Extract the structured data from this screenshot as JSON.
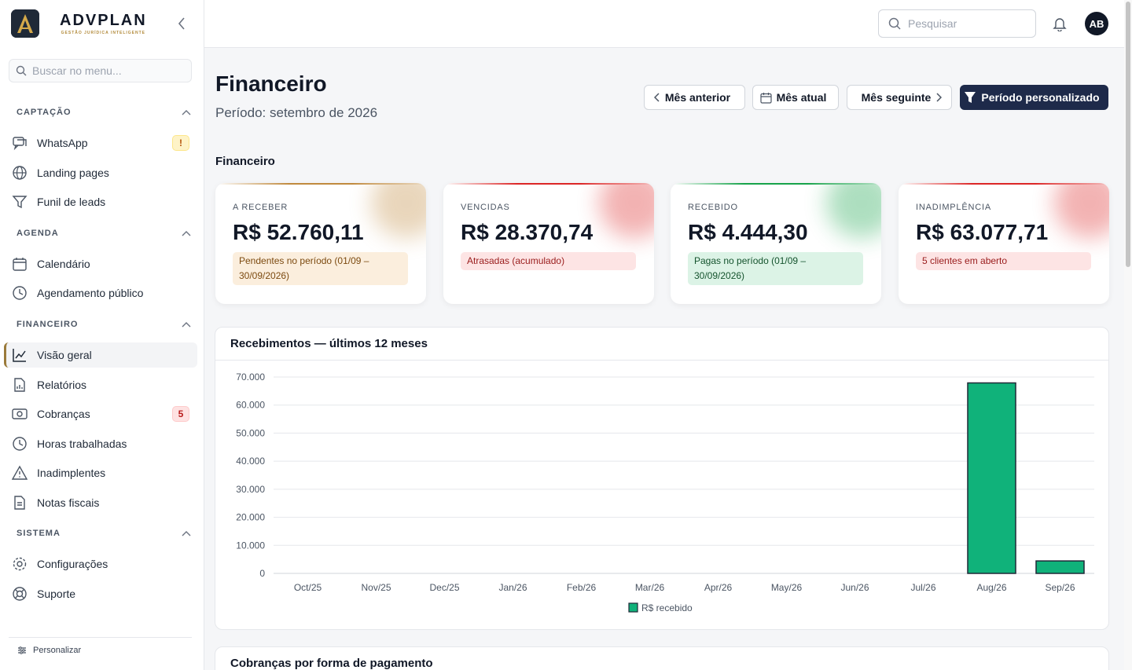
{
  "brand": {
    "name": "ADVPLAN",
    "tagline": "GESTÃO JURÍDICA INTELIGENTE"
  },
  "menu_search": {
    "placeholder": "Buscar no menu..."
  },
  "sidebar": {
    "sections": [
      {
        "title": "CAPTAÇÃO",
        "items": [
          {
            "label": "WhatsApp",
            "icon": "whatsapp-chat-icon",
            "badge": "!"
          },
          {
            "label": "Landing pages",
            "icon": "globe-icon"
          },
          {
            "label": "Funil de leads",
            "icon": "funnel-icon"
          }
        ]
      },
      {
        "title": "AGENDA",
        "items": [
          {
            "label": "Calendário",
            "icon": "calendar-icon"
          },
          {
            "label": "Agendamento público",
            "icon": "clock-icon"
          }
        ]
      },
      {
        "title": "FINANCEIRO",
        "items": [
          {
            "label": "Visão geral",
            "icon": "chart-line-icon"
          },
          {
            "label": "Relatórios",
            "icon": "report-icon"
          },
          {
            "label": "Cobranças",
            "icon": "money-icon",
            "badge": "5"
          },
          {
            "label": "Horas trabalhadas",
            "icon": "clock-icon"
          },
          {
            "label": "Inadimplentes",
            "icon": "warning-icon"
          },
          {
            "label": "Notas fiscais",
            "icon": "document-icon"
          }
        ]
      },
      {
        "title": "SISTEMA",
        "items": [
          {
            "label": "Configurações",
            "icon": "gear-icon"
          },
          {
            "label": "Suporte",
            "icon": "lifebuoy-icon"
          }
        ]
      }
    ],
    "footer": "Personalizar"
  },
  "topbar": {
    "search_placeholder": "Pesquisar",
    "avatar": "AB"
  },
  "header": {
    "title": "Financeiro",
    "period": "Período: setembro de 2026",
    "buttons": {
      "prev": "Mês anterior",
      "current": "Mês atual",
      "next": "Mês seguinte",
      "custom": "Período personalizado"
    }
  },
  "summary": {
    "title": "Financeiro",
    "cards": [
      {
        "label": "A RECEBER",
        "value": "R$ 52.760,11",
        "note": "Pendentes no período (01/09 – 30/09/2026)",
        "accent": "#c08a3e",
        "pill_bg": "#fbeedd",
        "pill_fg": "#7c4a10"
      },
      {
        "label": "VENCIDAS",
        "value": "R$ 28.370,74",
        "note": "Atrasadas (acumulado)",
        "accent": "#dc2626",
        "pill_bg": "#fde4e4",
        "pill_fg": "#991b1b"
      },
      {
        "label": "RECEBIDO",
        "value": "R$ 4.444,30",
        "note": "Pagas no período (01/09 – 30/09/2026)",
        "accent": "#16a34a",
        "pill_bg": "#dcf3e6",
        "pill_fg": "#14532d"
      },
      {
        "label": "INADIMPLÊNCIA",
        "value": "R$ 63.077,71",
        "note": "5 clientes em aberto",
        "accent": "#dc2626",
        "pill_bg": "#fde4e4",
        "pill_fg": "#991b1b"
      }
    ]
  },
  "chart_section": {
    "title": "Recebimentos — últimos 12 meses"
  },
  "chart_data": {
    "type": "bar",
    "categories": [
      "Oct/25",
      "Nov/25",
      "Dec/25",
      "Jan/26",
      "Feb/26",
      "Mar/26",
      "Apr/26",
      "May/26",
      "Jun/26",
      "Jul/26",
      "Aug/26",
      "Sep/26"
    ],
    "series": [
      {
        "name": "R$ recebido",
        "values": [
          0,
          0,
          0,
          0,
          0,
          0,
          0,
          0,
          0,
          0,
          67900,
          4444.3
        ],
        "color": "#10b27a"
      }
    ],
    "ylim": [
      0,
      70000
    ],
    "yticks": [
      0,
      10000,
      20000,
      30000,
      40000,
      50000,
      60000,
      70000
    ],
    "ytick_labels": [
      "0",
      "10.000",
      "20.000",
      "30.000",
      "40.000",
      "50.000",
      "60.000",
      "70.000"
    ],
    "grid": true,
    "legend": "bottom"
  },
  "second_section": {
    "title": "Cobranças por forma de pagamento"
  }
}
